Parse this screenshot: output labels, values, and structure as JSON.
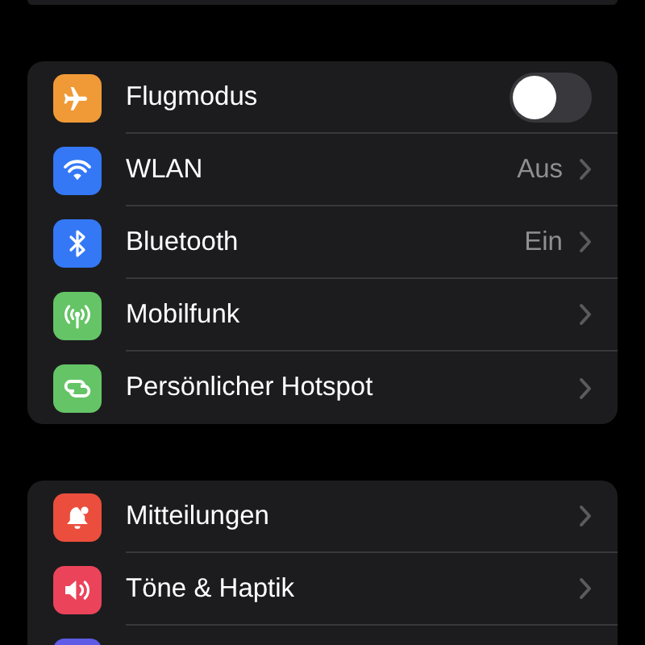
{
  "groups": [
    {
      "rows": [
        {
          "kind": "toggle",
          "label": "Flugmodus",
          "on": false
        },
        {
          "kind": "link",
          "label": "WLAN",
          "value": "Aus"
        },
        {
          "kind": "link",
          "label": "Bluetooth",
          "value": "Ein"
        },
        {
          "kind": "link",
          "label": "Mobilfunk"
        },
        {
          "kind": "link",
          "label": "Persönlicher Hotspot"
        }
      ]
    },
    {
      "rows": [
        {
          "kind": "link",
          "label": "Mitteilungen"
        },
        {
          "kind": "link",
          "label": "Töne & Haptik"
        },
        {
          "kind": "cut"
        }
      ]
    }
  ]
}
